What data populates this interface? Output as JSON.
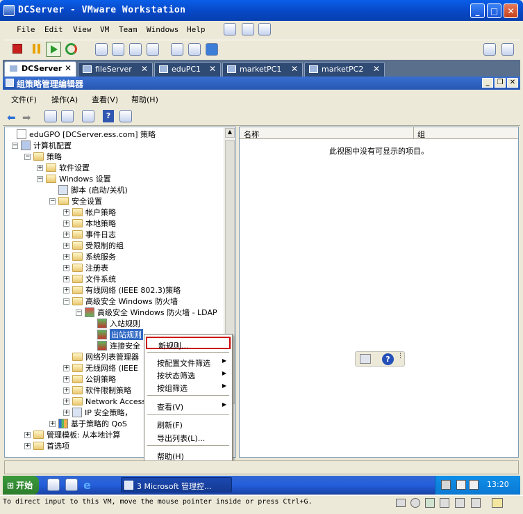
{
  "window": {
    "title": "DCServer - VMware Workstation",
    "minimize": "_",
    "maximize": "□",
    "close": "✕"
  },
  "menubar": {
    "items": [
      "File",
      "Edit",
      "View",
      "VM",
      "Team",
      "Windows",
      "Help"
    ]
  },
  "tabs": [
    {
      "label": "DCServer",
      "active": true
    },
    {
      "label": "fileServer",
      "active": false
    },
    {
      "label": "eduPC1",
      "active": false
    },
    {
      "label": "marketPC1",
      "active": false
    },
    {
      "label": "marketPC2",
      "active": false
    }
  ],
  "inner_window": {
    "title": "组策略管理编辑器"
  },
  "inner_menu": {
    "items": [
      "文件(F)",
      "操作(A)",
      "查看(V)",
      "帮助(H)"
    ]
  },
  "tree": [
    {
      "label": "eduGPO [DCServer.ess.com] 策略",
      "expander": ""
    },
    {
      "label": "计算机配置",
      "expander": "−"
    },
    {
      "label": "策略",
      "expander": "−"
    },
    {
      "label": "软件设置",
      "expander": "+"
    },
    {
      "label": "Windows 设置",
      "expander": "−"
    },
    {
      "label": "脚本 (启动/关机)",
      "expander": ""
    },
    {
      "label": "安全设置",
      "expander": "−"
    },
    {
      "label": "帐户策略",
      "expander": "+"
    },
    {
      "label": "本地策略",
      "expander": "+"
    },
    {
      "label": "事件日志",
      "expander": "+"
    },
    {
      "label": "受限制的组",
      "expander": "+"
    },
    {
      "label": "系统服务",
      "expander": "+"
    },
    {
      "label": "注册表",
      "expander": "+"
    },
    {
      "label": "文件系统",
      "expander": "+"
    },
    {
      "label": "有线网络 (IEEE 802.3)策略",
      "expander": "+"
    },
    {
      "label": "高级安全 Windows 防火墙",
      "expander": "−"
    },
    {
      "label": "高级安全 Windows 防火墙 - LDAP",
      "expander": "−"
    },
    {
      "label": "入站规则",
      "expander": ""
    },
    {
      "label": "出站规则",
      "expander": "",
      "selected": true
    },
    {
      "label": "连接安全",
      "expander": ""
    },
    {
      "label": "网络列表管理器",
      "expander": ""
    },
    {
      "label": "无线网络 (IEEE",
      "expander": "+"
    },
    {
      "label": "公钥策略",
      "expander": "+"
    },
    {
      "label": "软件限制策略",
      "expander": "+"
    },
    {
      "label": "Network Access",
      "expander": "+"
    },
    {
      "label": "IP 安全策略，",
      "expander": "+"
    },
    {
      "label": "基于策略的 QoS",
      "expander": "+"
    },
    {
      "label": "管理模板: 从本地计算",
      "expander": "+"
    },
    {
      "label": "首选项",
      "expander": "+"
    }
  ],
  "list": {
    "columns": [
      "名称",
      "组"
    ],
    "empty_message": "此视图中没有可显示的项目。"
  },
  "context_menu": {
    "items": [
      {
        "label": "新规则...",
        "submenu": false,
        "highlighted": true
      },
      {
        "label": "按配置文件筛选",
        "submenu": true
      },
      {
        "label": "按状态筛选",
        "submenu": true
      },
      {
        "label": "按组筛选",
        "submenu": true
      },
      {
        "label": "查看(V)",
        "submenu": true
      },
      {
        "label": "刷新(F)",
        "submenu": false
      },
      {
        "label": "导出列表(L)...",
        "submenu": false
      },
      {
        "label": "帮助(H)",
        "submenu": false
      }
    ]
  },
  "taskbar": {
    "start": "开始",
    "task": "3 Microsoft 管理控...",
    "clock": "13:20"
  },
  "vm_status": {
    "message": "To direct input to this VM, move the mouse pointer inside or press Ctrl+G."
  },
  "colors": {
    "titlebar": "#0848c6",
    "selection": "#316ac5",
    "highlight_border": "#cc0000"
  }
}
